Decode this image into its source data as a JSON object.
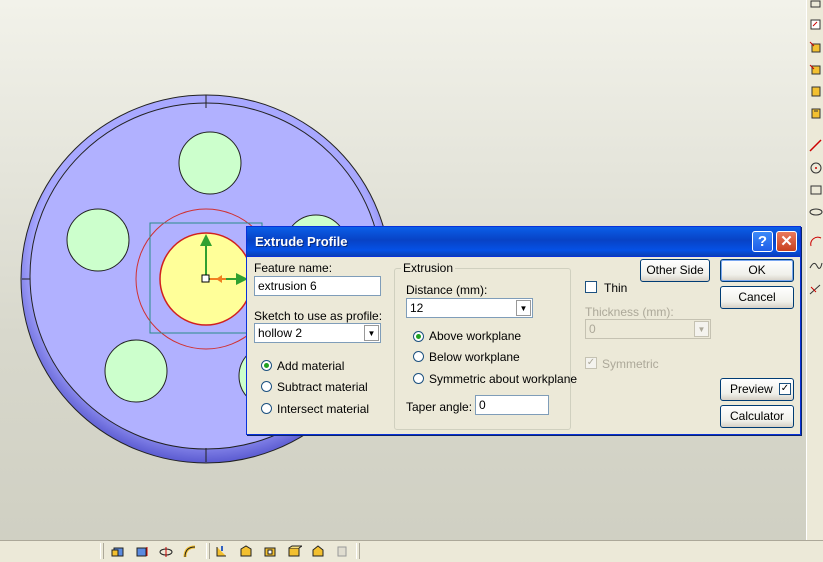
{
  "dialog": {
    "title": "Extrude Profile",
    "help_label": "?",
    "close_label": "✕",
    "feature_name_label": "Feature name:",
    "feature_name_value": "extrusion 6",
    "sketch_label": "Sketch to use as profile:",
    "sketch_value": "hollow 2",
    "material_options": [
      {
        "label": "Add material",
        "selected": true
      },
      {
        "label": "Subtract material",
        "selected": false
      },
      {
        "label": "Intersect material",
        "selected": false
      }
    ],
    "extrusion": {
      "group_label": "Extrusion",
      "distance_label": "Distance (mm):",
      "distance_value": "12",
      "direction_options": [
        {
          "label": "Above workplane",
          "selected": true
        },
        {
          "label": "Below workplane",
          "selected": false
        },
        {
          "label": "Symmetric about workplane",
          "selected": false
        }
      ],
      "taper_label": "Taper angle:",
      "taper_value": "0"
    },
    "thin": {
      "thin_label": "Thin",
      "thickness_label": "Thickness (mm):",
      "thickness_value": "0",
      "symmetric_label": "Symmetric"
    },
    "buttons": {
      "other_side": "Other Side",
      "ok": "OK",
      "cancel": "Cancel",
      "preview": "Preview",
      "calculator": "Calculator"
    }
  },
  "icons": {
    "right_toolbar": [
      "sketch-tool-icon",
      "workplane-icon",
      "extrude-icon",
      "revolve-icon",
      "sweep-icon",
      "loft-icon",
      "line-icon",
      "circle-icon",
      "rectangle-icon",
      "ellipse-icon",
      "arc-icon",
      "spline-icon",
      "dimension-icon"
    ],
    "bottom_toolbar": [
      "extrude-icon",
      "cut-icon",
      "revolve-icon",
      "sweep-icon",
      "fillet-icon",
      "chamfer-icon",
      "shell-icon",
      "draft-icon",
      "pattern-icon",
      "mirror-icon"
    ]
  },
  "colors": {
    "disc_face": "#b1b1ff",
    "disc_rim": "#8c8ce6",
    "hole_fill": "#ccffcc",
    "selected_profile": "#ffff99",
    "accent": "#0a5fe8"
  }
}
